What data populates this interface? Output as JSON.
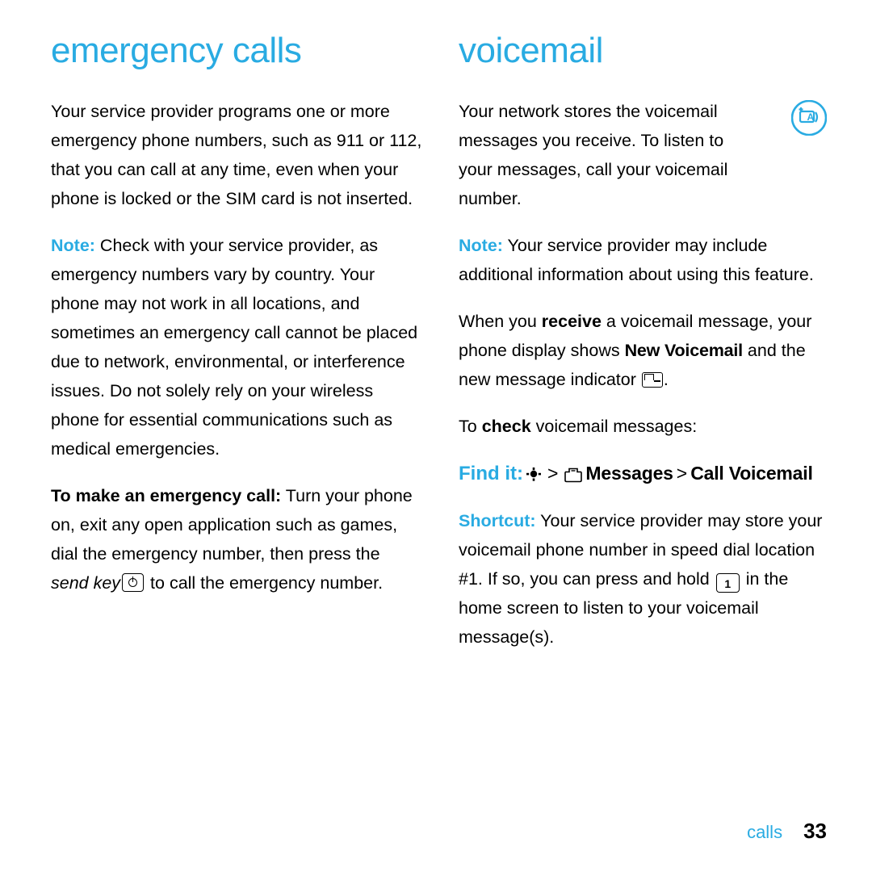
{
  "left_column": {
    "title": "emergency calls",
    "paragraphs": [
      {
        "id": "p1",
        "segments": [
          {
            "text": "Your service provider programs one or more emergency phone numbers, such as 911 or 112, that you can call at any time, even when your phone is locked or the SIM card is not inserted."
          }
        ]
      },
      {
        "id": "p2",
        "label": "Note:",
        "segments": [
          {
            "text": " Check with your service provider, as emergency numbers vary by country. Your phone may not work in all locations, and sometimes an emergency call cannot be placed due to network, environmental, or interference issues. Do not solely rely on your wireless phone for essential communications such as medical emergencies."
          }
        ]
      },
      {
        "id": "p3",
        "bold_lead": "To make an emergency call:",
        "segments": [
          {
            "text": " Turn your phone on, exit any open application such as games, dial the emergency number, then press the "
          },
          {
            "text": "send key",
            "style": "italic"
          },
          {
            "icon": "send-key-icon"
          },
          {
            "text": " to call the emergency number."
          }
        ]
      }
    ]
  },
  "right_column": {
    "title": "voicemail",
    "paragraphs": [
      {
        "id": "r1",
        "segments": [
          {
            "text": "Your network stores the voicemail messages you receive. To listen to your messages, call your voicemail number."
          }
        ]
      },
      {
        "id": "r2",
        "label": "Note:",
        "segments": [
          {
            "text": " Your service provider may include additional information about using this feature."
          }
        ]
      },
      {
        "id": "r3",
        "segments": [
          {
            "text": "When you "
          },
          {
            "text": "receive",
            "style": "bold"
          },
          {
            "text": " a voicemail message, your phone display shows "
          },
          {
            "text": "New Voicemail",
            "style": "condensed-bold"
          },
          {
            "text": " and the new message indicator "
          },
          {
            "icon": "message-indicator-icon"
          },
          {
            "text": "."
          }
        ]
      },
      {
        "id": "r4",
        "segments": [
          {
            "text": "To "
          },
          {
            "text": "check",
            "style": "bold"
          },
          {
            "text": " voicemail messages:"
          }
        ]
      }
    ],
    "find_it": {
      "label": "Find it:",
      "menu_icon": "menu-key-icon",
      "separator_1": ">",
      "messages_icon": "messages-folder-icon",
      "messages_label": "Messages",
      "separator_2": ">",
      "target_label": "Call Voicemail"
    },
    "shortcut": {
      "label": "Shortcut:",
      "segments": [
        {
          "text": " Your service provider may store your voicemail phone number in speed dial location #1. If so, you can press and hold "
        },
        {
          "icon": "key-1-icon",
          "text": "1"
        },
        {
          "text": " in the home screen to listen to your voicemail message(s)."
        }
      ]
    },
    "corner_icon": "voicemail-badge-icon"
  },
  "footer": {
    "section": "calls",
    "page_number": "33"
  },
  "colors": {
    "accent": "#29ABE2",
    "text": "#000000",
    "background": "#FFFFFF"
  }
}
